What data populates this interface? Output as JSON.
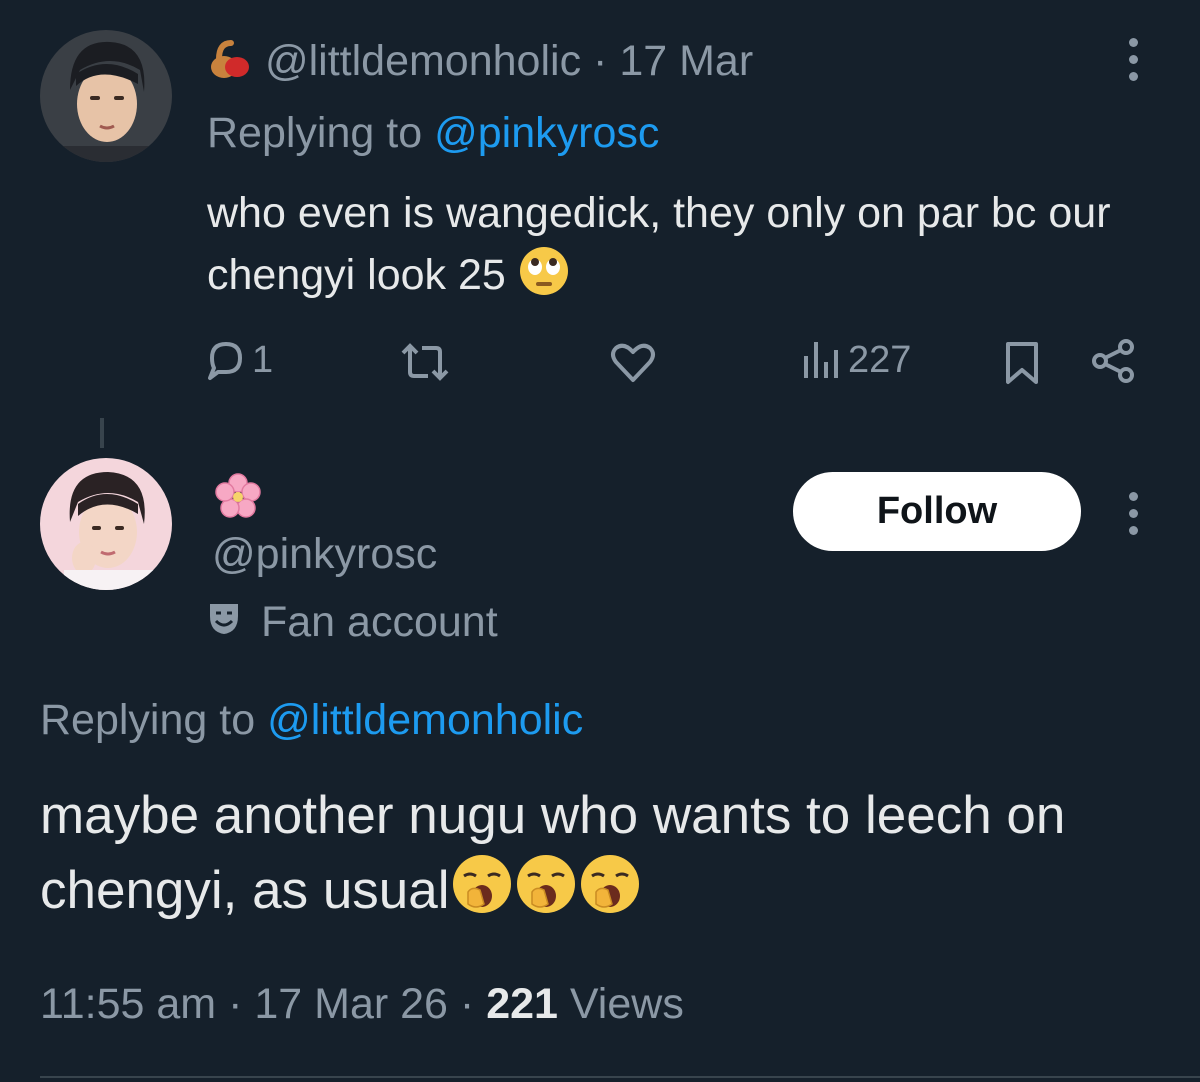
{
  "tweet1": {
    "handle": "@littldemonholic",
    "separator": "·",
    "date": "17 Mar",
    "replying_prefix": "Replying to",
    "replying_handle": "@pinkyrosc",
    "text": "who even is wangedick, they only on par bc our chengyi look 25",
    "name_emoji": "peanut-icon",
    "text_emoji": "rolling-eyes-emoji",
    "actions": {
      "reply_count": "1",
      "retweet_count": "",
      "like_count": "",
      "views_count": "227"
    }
  },
  "tweet2": {
    "name_emoji": "cherry-blossom-icon",
    "handle": "@pinkyrosc",
    "label": "Fan account",
    "follow_label": "Follow",
    "replying_prefix": "Replying to",
    "replying_handle": "@littldemonholic",
    "text": "maybe another nugu who wants to leech on chengyi, as usual",
    "text_emoji": "yawning-face-emoji",
    "time": "11:55 am",
    "sep1": "·",
    "date": "17 Mar 26",
    "sep2": "·",
    "views_count": "221",
    "views_label": "Views"
  },
  "colors": {
    "background": "#15202b",
    "text": "#e7e9ea",
    "muted": "#8b98a5",
    "link": "#1d9bf0"
  }
}
